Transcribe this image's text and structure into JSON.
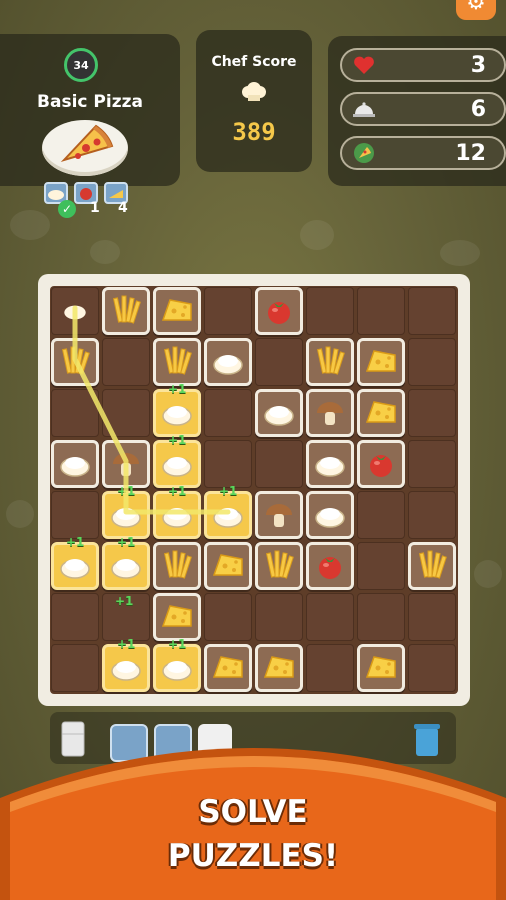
{
  "recipe": {
    "timer": "34",
    "title": "Basic Pizza",
    "requirements": [
      {
        "icon": "dough-icon",
        "done": true
      },
      {
        "icon": "tomato-icon",
        "count": "1"
      },
      {
        "icon": "cheese-icon",
        "count": "4"
      }
    ]
  },
  "score": {
    "label": "Chef Score",
    "value": "389"
  },
  "stats": [
    {
      "icon": "heart-icon",
      "value": "3"
    },
    {
      "icon": "cloche-icon",
      "value": "6"
    },
    {
      "icon": "pizza-icon",
      "value": "12"
    }
  ],
  "board": {
    "rows": [
      [
        "dough-drag",
        "fries",
        "cheese",
        "",
        "tomato",
        "",
        "",
        ""
      ],
      [
        "fries",
        "",
        "fries",
        "dough",
        "",
        "fries",
        "cheese",
        ""
      ],
      [
        "",
        "",
        "dough+1",
        "",
        "dough",
        "mushroom",
        "cheese",
        ""
      ],
      [
        "dough",
        "mushroom",
        "dough+1",
        "",
        "",
        "dough",
        "tomato",
        ""
      ],
      [
        "",
        "dough+1",
        "dough+1",
        "dough+1",
        "mushroom",
        "dough",
        "",
        ""
      ],
      [
        "dough+1",
        "dough+1",
        "fries",
        "cheese",
        "fries",
        "tomato",
        "",
        "fries"
      ],
      [
        "",
        "",
        "cheese",
        "",
        "",
        "",
        "",
        ""
      ],
      [
        "",
        "dough+1",
        "dough+1",
        "cheese",
        "cheese",
        "",
        "cheese",
        ""
      ]
    ],
    "plus_label": "+1",
    "floating_plus": "+1"
  },
  "banner": {
    "line1": "SOLVE",
    "line2": "PUZZLES!"
  },
  "colors": {
    "accent": "#f08a33",
    "selected": "#f5c84a",
    "plus": "#59d65c"
  }
}
